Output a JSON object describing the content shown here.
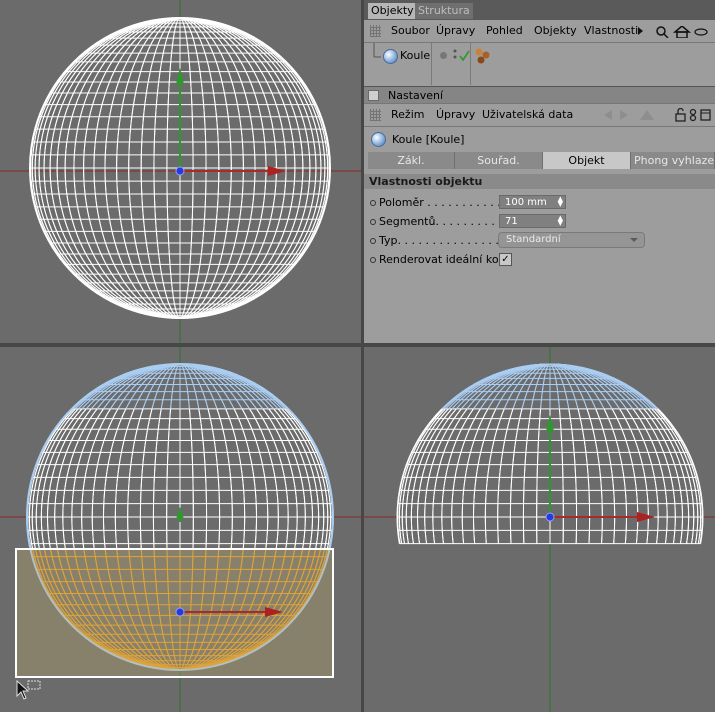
{
  "panel": {
    "tabs": [
      "Objekty",
      "Struktura"
    ],
    "object_menu": [
      "Soubor",
      "Úpravy",
      "Pohled",
      "Objekty",
      "Vlastnosti"
    ],
    "object_name": "Koule",
    "settings_header": "Nastavení",
    "attr_menu": [
      "Režim",
      "Úpravy",
      "Uživatelská data"
    ],
    "object_title": "Koule [Koule]",
    "subtabs": [
      "Zákl.",
      "Souřad.",
      "Objekt",
      "Phong vyhlazení"
    ],
    "section": "Vlastnosti objektu",
    "props": {
      "radius_label": "Poloměr . . . . . . . . . . . . . .",
      "radius_value": "100 mm",
      "segments_label": "Segmentů. . . . . . . . . . . . . .",
      "segments_value": "71",
      "type_label": "Typ. . . . . . . . . . . . . . . . . .",
      "type_value": "Standardní",
      "render_label": "Renderovat ideální kouli",
      "render_checked": true
    }
  },
  "colors": {
    "viewport_bg": "#6b6b6b",
    "wire": "#ffffff",
    "selected_edge": "#aacdf2",
    "selected_poly": "#f0a020",
    "axis_x": "#8a1a1a",
    "axis_y": "#2a8a2a",
    "selection_box": "#ffffff"
  }
}
